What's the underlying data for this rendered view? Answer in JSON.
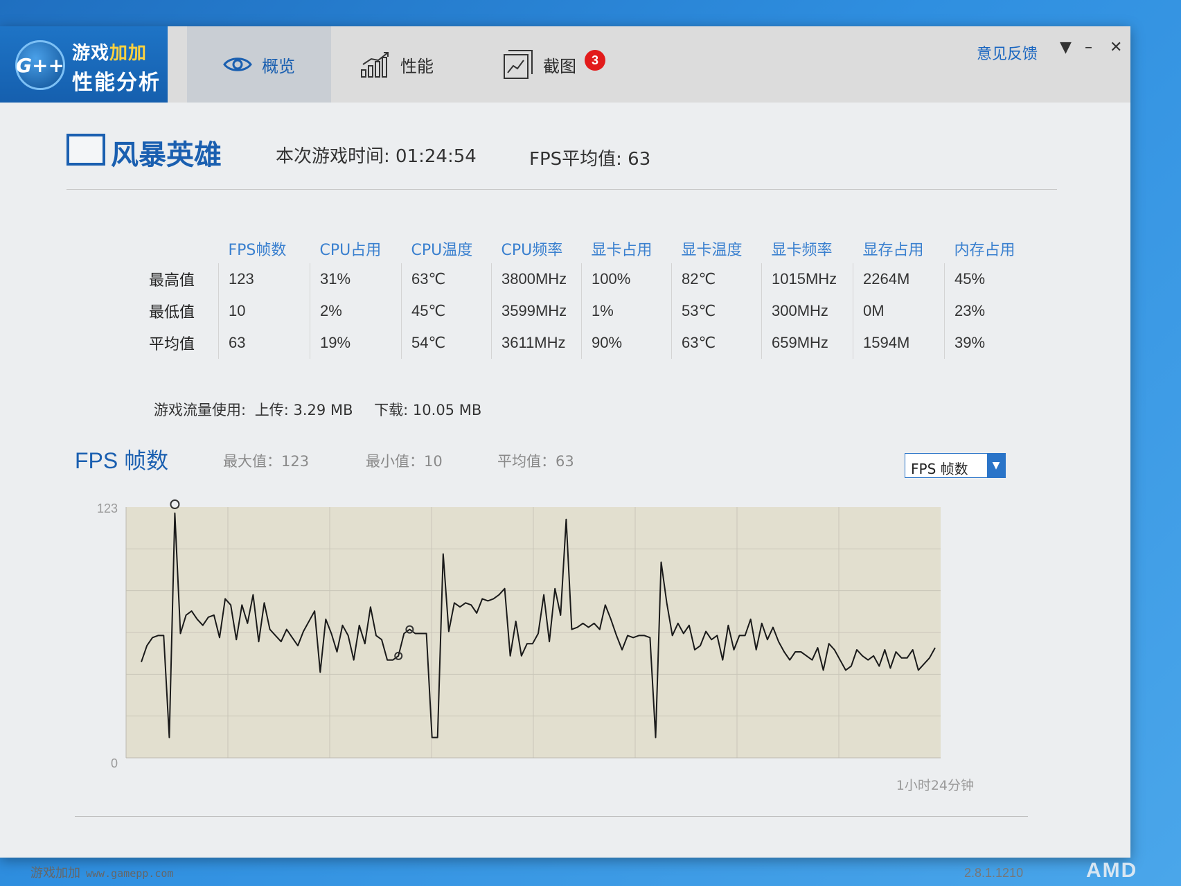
{
  "brand": {
    "logo_text": "G++",
    "title_line1_a": "游戏",
    "title_line1_b": "加加",
    "title_line2": "性能分析"
  },
  "tabs": [
    {
      "label": "概览",
      "icon": "eye-icon"
    },
    {
      "label": "性能",
      "icon": "bar-chart-icon"
    },
    {
      "label": "截图",
      "icon": "picture-icon",
      "badge": "3"
    }
  ],
  "header": {
    "feedback": "意见反馈",
    "menu_glyph": "▼",
    "min_glyph": "–",
    "close_glyph": "✕"
  },
  "game": {
    "name": "风暴英雄",
    "playtime_label": "本次游戏时间: 01:24:54",
    "fps_avg_label": "FPS平均值: 63"
  },
  "stats": {
    "columns": [
      "FPS帧数",
      "CPU占用",
      "CPU温度",
      "CPU频率",
      "显卡占用",
      "显卡温度",
      "显卡频率",
      "显存占用",
      "内存占用"
    ],
    "rows": [
      {
        "label": "最高值",
        "values": [
          "123",
          "31%",
          "63℃",
          "3800MHz",
          "100%",
          "82℃",
          "1015MHz",
          "2264M",
          "45%"
        ]
      },
      {
        "label": "最低值",
        "values": [
          "10",
          "2%",
          "45℃",
          "3599MHz",
          "1%",
          "53℃",
          "300MHz",
          "0M",
          "23%"
        ]
      },
      {
        "label": "平均值",
        "values": [
          "63",
          "19%",
          "54℃",
          "3611MHz",
          "90%",
          "63℃",
          "659MHz",
          "1594M",
          "39%"
        ]
      }
    ]
  },
  "traffic": {
    "label": "游戏流量使用:",
    "upload": "上传: 3.29 MB",
    "download": "下载: 10.05 MB"
  },
  "chart_section": {
    "title": "FPS 帧数",
    "max": "最大值：123",
    "min": "最小值：10",
    "avg": "平均值：63",
    "select_value": "FPS 帧数"
  },
  "chart_data": {
    "type": "line",
    "ylim": [
      0,
      123
    ],
    "y_ticks": [
      "123",
      "0"
    ],
    "x_end_label": "1小时24分钟",
    "xlim": [
      0,
      100
    ],
    "grid": true,
    "fill": "#e2dfcf",
    "line_color": "#1a1a1a",
    "values": [
      47,
      55,
      59,
      60,
      60,
      10,
      120,
      61,
      70,
      72,
      68,
      65,
      69,
      70,
      59,
      78,
      75,
      58,
      75,
      66,
      80,
      57,
      76,
      63,
      60,
      57,
      63,
      59,
      55,
      62,
      67,
      72,
      42,
      68,
      61,
      52,
      65,
      60,
      48,
      65,
      56,
      74,
      60,
      58,
      48,
      48,
      50,
      61,
      63,
      61,
      61,
      61,
      10,
      10,
      100,
      62,
      76,
      74,
      76,
      75,
      71,
      78,
      77,
      78,
      80,
      83,
      50,
      67,
      50,
      56,
      56,
      61,
      80,
      57,
      83,
      70,
      117,
      63,
      64,
      66,
      64,
      66,
      63,
      75,
      68,
      60,
      53,
      60,
      59,
      60,
      60,
      59,
      10,
      96,
      76,
      60,
      66,
      61,
      65,
      53,
      55,
      62,
      58,
      60,
      48,
      65,
      53,
      60,
      60,
      68,
      53,
      66,
      58,
      64,
      57,
      52,
      48,
      52,
      52,
      50,
      48,
      54,
      43,
      56,
      53,
      48,
      43,
      45,
      53,
      50,
      48,
      50,
      45,
      53,
      44,
      52,
      49,
      49,
      53,
      43,
      46,
      49,
      54
    ]
  },
  "footer": {
    "app": "游戏加加",
    "url": "www.gamepp.com",
    "version": "2.8.1.1210"
  },
  "corner_logo": "AMD"
}
